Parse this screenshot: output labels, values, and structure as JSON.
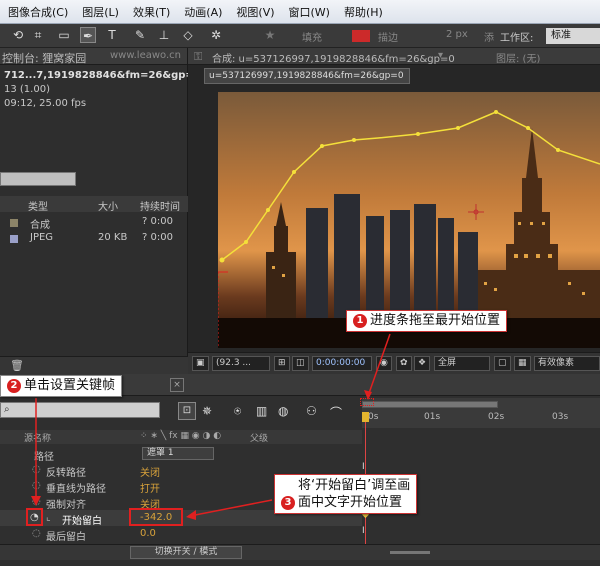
{
  "menubar": {
    "items": [
      "图像合成(C)",
      "图层(L)",
      "效果(T)",
      "动画(A)",
      "视图(V)",
      "窗口(W)",
      "帮助(H)"
    ]
  },
  "toolbar": {
    "fill_label": "填充",
    "stroke_label": "描边",
    "stroke_size": "2 px",
    "add_label": "添",
    "workspace_label": "工作区:",
    "workspace_value": "标准"
  },
  "project_panel": {
    "tab_label": "控制台: 狸窝家园",
    "url_text": "www.leawo.cn",
    "info_line1": "712...7,1919828846&fm=26&gp=0▾",
    "info_line2": "13 (1.00)",
    "info_line3": "09:12, 25.00 fps",
    "columns": {
      "type": "类型",
      "size": "大小",
      "duration": "持续时间"
    },
    "rows": [
      {
        "name": "合成",
        "type_color": "#8c8468",
        "size": "",
        "duration": "? 0:00"
      },
      {
        "name": "JPEG",
        "type_color": "#9aa0c8",
        "size": "20 KB",
        "duration": "? 0:00"
      }
    ]
  },
  "composition_panel": {
    "tab_label": "合成: u=537126997,1919828846&fm=26&gp=0",
    "layer_tab_label": "图层: (无)",
    "subtab_label": "u=537126997,1919828846&fm=26&gp=0",
    "zoom_value": "(92.3 ...",
    "timecode": "0:00:00:00",
    "resolution_value": "全屏",
    "pixel_label": "有效像素"
  },
  "timeline": {
    "search_placeholder": "",
    "col_header_name": "源名称",
    "col_header_parent": "父级",
    "ruler_labels": [
      "0s",
      "01s",
      "02s",
      "03s"
    ],
    "switch_mode_label": "切换开关 / 模式",
    "properties": [
      {
        "name": "路径",
        "value": "遮罩 1"
      },
      {
        "name": "反转路径",
        "value": "关闭"
      },
      {
        "name": "垂直线为路径",
        "value": "打开"
      },
      {
        "name": "强制对齐",
        "value": "关闭"
      },
      {
        "name": "开始留白",
        "value": "-342.0"
      },
      {
        "name": "最后留白",
        "value": "0.0"
      }
    ]
  },
  "callouts": {
    "c1": {
      "num": "1",
      "text": "进度条拖至最开始位置"
    },
    "c2": {
      "num": "2",
      "text": "单击设置关键帧"
    },
    "c3": {
      "num": "3",
      "line1": "将‘开始留白’调至画",
      "line2": "面中文字开始位置"
    }
  },
  "colors": {
    "accent_red": "#e02020",
    "path_yellow": "#f4e03a",
    "value_orange": "#d7a13a"
  }
}
